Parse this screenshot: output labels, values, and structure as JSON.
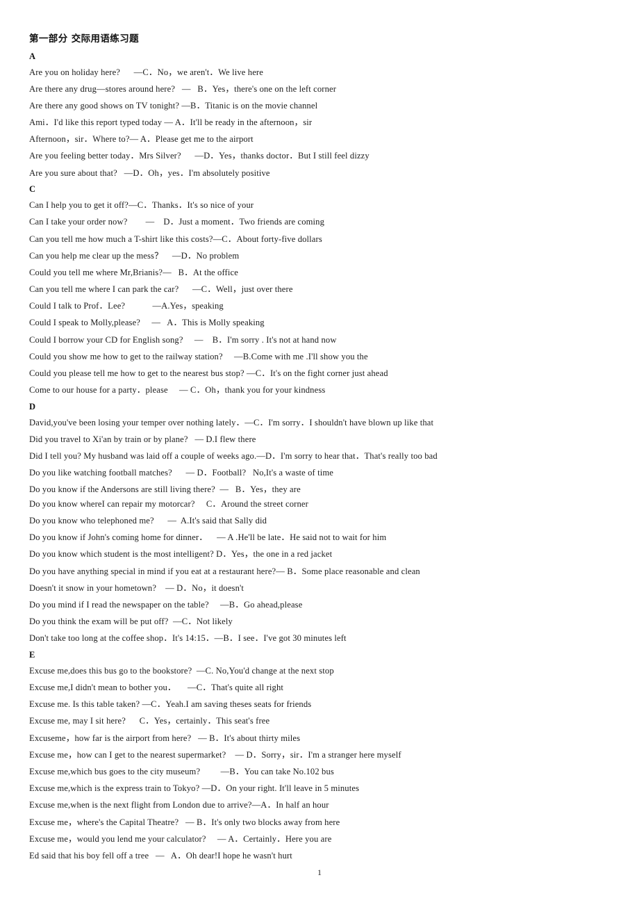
{
  "document": {
    "title": "第一部分  交际用语练习题",
    "page_number": "1"
  },
  "sections": [
    {
      "letter": "A",
      "lines": [
        "Are you on holiday here?      —C．No，we aren't．We live here",
        "Are there any drug—stores around here?   —   B．Yes，there's one on the left corner",
        "Are there any good shows on TV tonight? —B．Titanic is on the movie channel",
        "Ami．I'd like this report typed today — A．It'll be ready in the afternoon，sir",
        "Afternoon，sir．Where to?— A．Please get me to the airport",
        "Are you feeling better today．Mrs Silver?      —D．Yes，thanks doctor．But I still feel dizzy",
        "Are you sure about that?   —D．Oh，yes．I'm absolutely positive"
      ]
    },
    {
      "letter": "C",
      "lines": [
        "Can I help you to get it off?—C．Thanks．It's so nice of your",
        "Can I take your order now?        —    D．Just a moment．Two friends are coming",
        "Can you tell me how much a T-shirt like this costs?—C．About forty-five dollars",
        "Can you help me clear up the mess？    —D．No problem",
        "Could you tell me where Mr,Brianis?—   B．At the office",
        "Can you tell me where I can park the car?      —C．Well，just over there",
        "Could I talk to Prof．Lee?            —A.Yes，speaking",
        "Could I speak to Molly,please?     —   A．This is Molly speaking",
        "Could I borrow your CD for English song?     —    B．I'm sorry . It's not at hand now",
        "Could you show me how to get to the railway station?     —B.Come with me .I'll show you the",
        "Could you please tell me how to get to the nearest bus stop? —C．It's on the fight corner just ahead",
        "Come to our house for a party．please     — C．Oh，thank you for your kindness"
      ]
    },
    {
      "letter": "D",
      "lines": [
        "David,you've been losing your temper over nothing lately．—C．I'm sorry．I shouldn't have blown up like that",
        "Did you travel to Xi'an by train or by plane?   — D.I flew there",
        "Did I tell you? My husband was laid off a couple of weeks ago.—D．I'm sorry to hear that．That's really too bad",
        "Do you like watching football matches?      — D．Football?   No,It's a waste of time",
        "Do you know if the Andersons are still living there?  —   B．Yes，they are",
        "Do you know whereI can repair my motorcar?     C．Around the street corner",
        "Do you know who telephoned me?      —  A.It's said that Sally did",
        "Do you know if John's coming home for dinner．    — A .He'll be late．He said not to wait for him",
        "Do you know which student is the most intelligent? D．Yes，the one in a red jacket",
        "Do you have anything special in mind if you eat at a restaurant here?— B．Some place reasonable and clean",
        "Doesn't it snow in your hometown?    — D．No，it doesn't",
        "Do you mind if I read the newspaper on the table?     —B．Go ahead,please",
        "Do you think the exam will be put off?  —C．Not likely",
        "Don't take too long at the coffee shop．It's 14:15．—B．I see．I've got 30 minutes left"
      ]
    },
    {
      "letter": "E",
      "lines": [
        "Excuse me,does this bus go to the bookstore?  —C. No,You'd change at the next stop",
        "Excuse me,I didn't mean to bother you．     —C．That's quite all right",
        "Excuse me. Is this table taken? —C．Yeah.I am saving theses seats for friends",
        "Excuse me, may I sit here?      C．Yes，certainly．This seat's free",
        "Excuseme，how far is the airport from here?   — B．It's about thirty miles",
        "Excuse me，how can I get to the nearest supermarket?    — D．Sorry，sir．I'm a stranger here myself",
        "Excuse me,which bus goes to the city museum?         —B．You can take No.102 bus",
        "Excuse me,which is the express train to Tokyo? —D．On your right. It'll leave in 5 minutes",
        "Excuse me,when is the next flight from London due to arrive?—A．In half an hour",
        "Excuse me，where's the Capital Theatre?   — B．It's only two blocks away from here",
        "Excuse me，would you lend me your calculator?     — A．Certainly．Here you are",
        "Ed said that his boy fell off a tree   —   A．Oh dear!I hope he wasn't hurt"
      ]
    }
  ]
}
